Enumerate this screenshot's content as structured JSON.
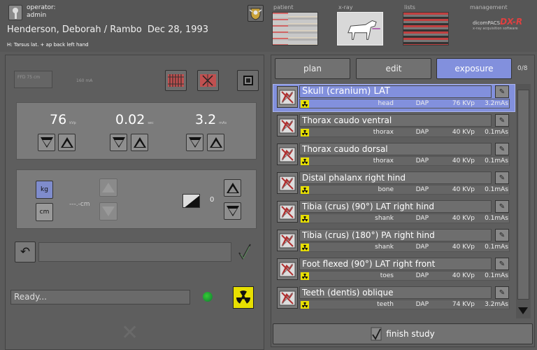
{
  "header": {
    "operator_label": "operator:",
    "operator_name": "admin",
    "patient_name": "Henderson, Deborah / Rambo",
    "patient_date": "Dec 28, 1993",
    "projection": "H: Tarsus lat. + ap back left hand"
  },
  "nav": {
    "patient": "patient",
    "xray": "x-ray",
    "lists": "lists",
    "management": "management",
    "logo_prefix": "dicomPACS",
    "logo_mark": "DX-R",
    "logo_sub": "x-ray acquisition software"
  },
  "generator": {
    "field": "FFD 75 cm",
    "ma": "160 mA"
  },
  "exposure": {
    "kv_value": "76",
    "kv_unit": "kVp",
    "mas_value": "0.02",
    "mas_unit": "sec",
    "ms_value": "3.2",
    "ms_unit": "mAs"
  },
  "secondary": {
    "kg_label": "kg",
    "cm_label": "cm",
    "thickness": "---.-cm",
    "density_value": "0"
  },
  "status": {
    "text": "Ready..."
  },
  "tabs": {
    "plan": "plan",
    "edit": "edit",
    "exposure": "exposure",
    "count": "0/8"
  },
  "items": [
    {
      "title": "Skull (cranium) LAT",
      "part": "head",
      "dap": "DAP",
      "kv": "76 KVp",
      "mas": "3.2mAs"
    },
    {
      "title": "Thorax caudo ventral",
      "part": "thorax",
      "dap": "DAP",
      "kv": "40 KVp",
      "mas": "0.1mAs"
    },
    {
      "title": "Thorax caudo dorsal",
      "part": "thorax",
      "dap": "DAP",
      "kv": "40 KVp",
      "mas": "0.1mAs"
    },
    {
      "title": "Distal phalanx right hind",
      "part": "bone",
      "dap": "DAP",
      "kv": "40 KVp",
      "mas": "0.1mAs"
    },
    {
      "title": "Tibia (crus) (90°) LAT right hind",
      "part": "shank",
      "dap": "DAP",
      "kv": "40 KVp",
      "mas": "0.1mAs"
    },
    {
      "title": "Tibia (crus) (180°) PA right hind",
      "part": "shank",
      "dap": "DAP",
      "kv": "40 KVp",
      "mas": "0.1mAs"
    },
    {
      "title": "Foot flexed (90°) LAT right front",
      "part": "toes",
      "dap": "DAP",
      "kv": "40 KVp",
      "mas": "0.1mAs"
    },
    {
      "title": "Teeth (dentis) oblique",
      "part": "teeth",
      "dap": "DAP",
      "kv": "74 KVp",
      "mas": "3.2mAs"
    }
  ],
  "footer": {
    "finish": "finish study"
  },
  "colors": {
    "accent": "#8290dd",
    "radiation": "#e8e000",
    "ready_led": "#33cc33"
  }
}
